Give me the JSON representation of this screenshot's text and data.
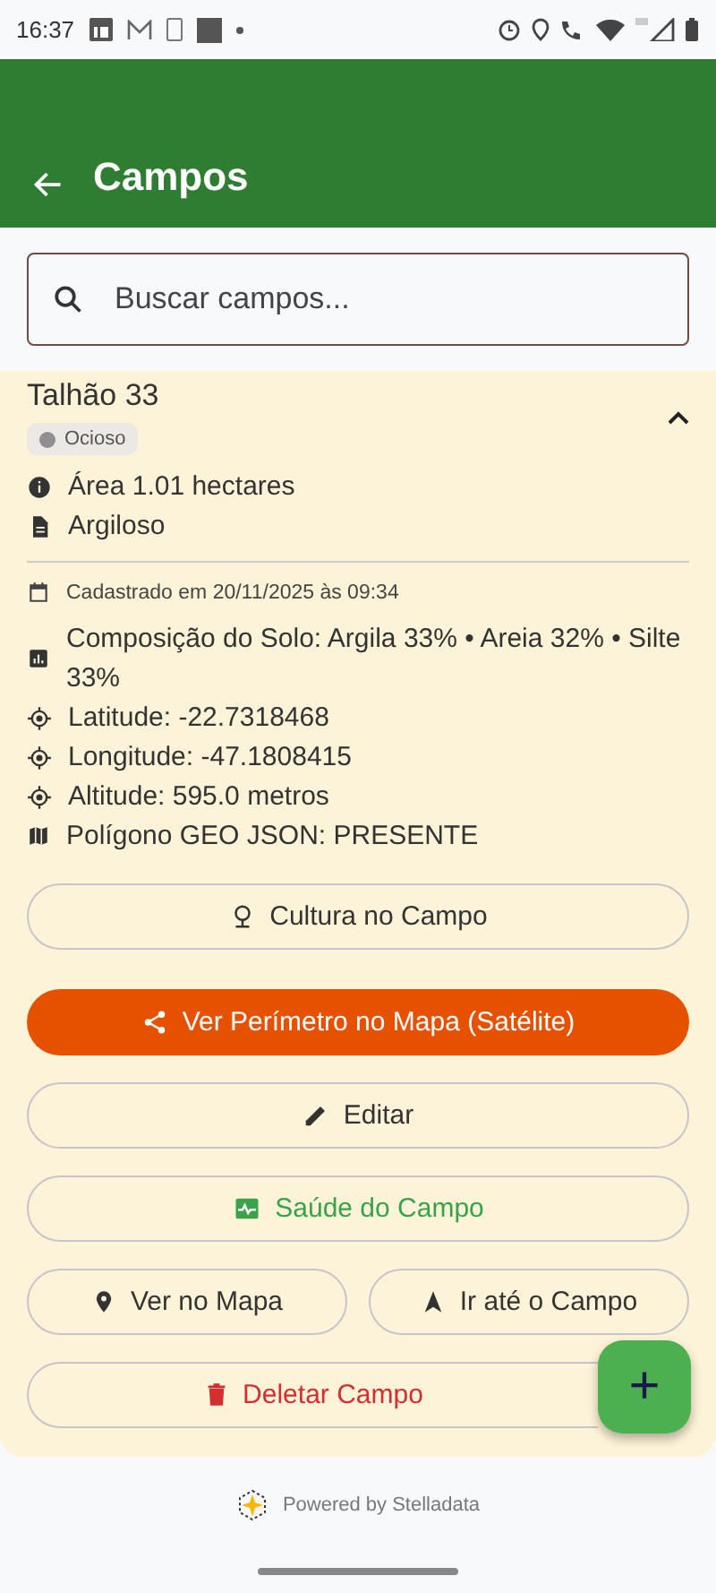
{
  "status_bar": {
    "time": "16:37"
  },
  "app_bar": {
    "title": "Campos"
  },
  "search": {
    "placeholder": "Buscar campos..."
  },
  "field": {
    "name": "Talhão 33",
    "expanded": true,
    "status": {
      "label": "Ocioso",
      "color": "#8e8e93"
    },
    "summary": [
      "Área 1.01 hectares",
      "Argiloso"
    ],
    "details": [
      {
        "kind": "meta",
        "text": "Cadastrado em 20/11/2025 às 09:34"
      },
      {
        "kind": "info",
        "text": "Composição do Solo: Argila 33% • Areia 32% • Silte 33%"
      },
      {
        "kind": "info",
        "text": "Latitude: -22.7318468"
      },
      {
        "kind": "info",
        "text": "Longitude: -47.1808415"
      },
      {
        "kind": "info",
        "text": "Altitude: 595.0 metros"
      },
      {
        "kind": "info",
        "text": "Polígono GEO JSON: PRESENTE"
      }
    ],
    "actions": [
      [
        {
          "label": "Cultura no Campo",
          "kind": "outline"
        }
      ],
      [
        {
          "label": "Ver Perímetro no Mapa (Satélite)",
          "kind": "filled"
        }
      ],
      [
        {
          "label": "Editar",
          "kind": "outline"
        }
      ],
      [
        {
          "label": "Saúde do Campo",
          "kind": "success"
        }
      ],
      [
        {
          "label": "Ver no Mapa",
          "kind": "outline"
        },
        {
          "label": "Ir até o Campo",
          "kind": "outline"
        }
      ],
      [
        {
          "label": "Deletar Campo",
          "kind": "danger"
        }
      ]
    ]
  },
  "fab": {
    "label": "+"
  },
  "footer": {
    "text": "Powered by Stelladata"
  }
}
